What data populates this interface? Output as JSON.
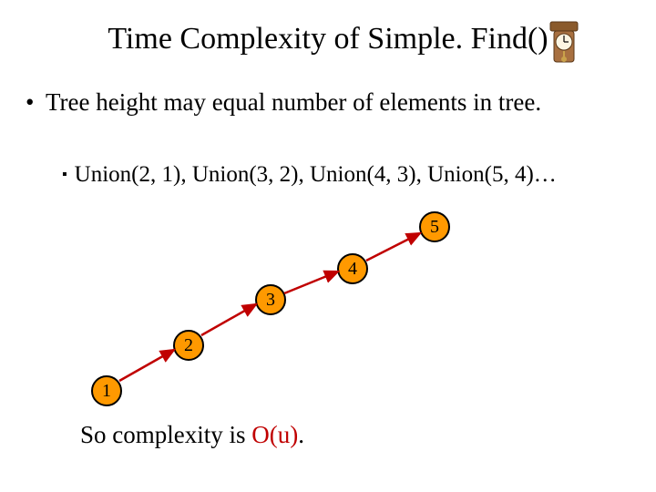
{
  "title": "Time Complexity of Simple. Find()",
  "bullet_main": "Tree height may equal number of elements in tree.",
  "bullet_sub": "Union(2, 1), Union(3, 2), Union(4, 3), Union(5, 4)…",
  "conclusion_prefix": "So complexity is ",
  "conclusion_bigO": "O(u)",
  "conclusion_suffix": ".",
  "nodes": {
    "n1": "1",
    "n2": "2",
    "n3": "3",
    "n4": "4",
    "n5": "5"
  },
  "icon": "clock-icon"
}
